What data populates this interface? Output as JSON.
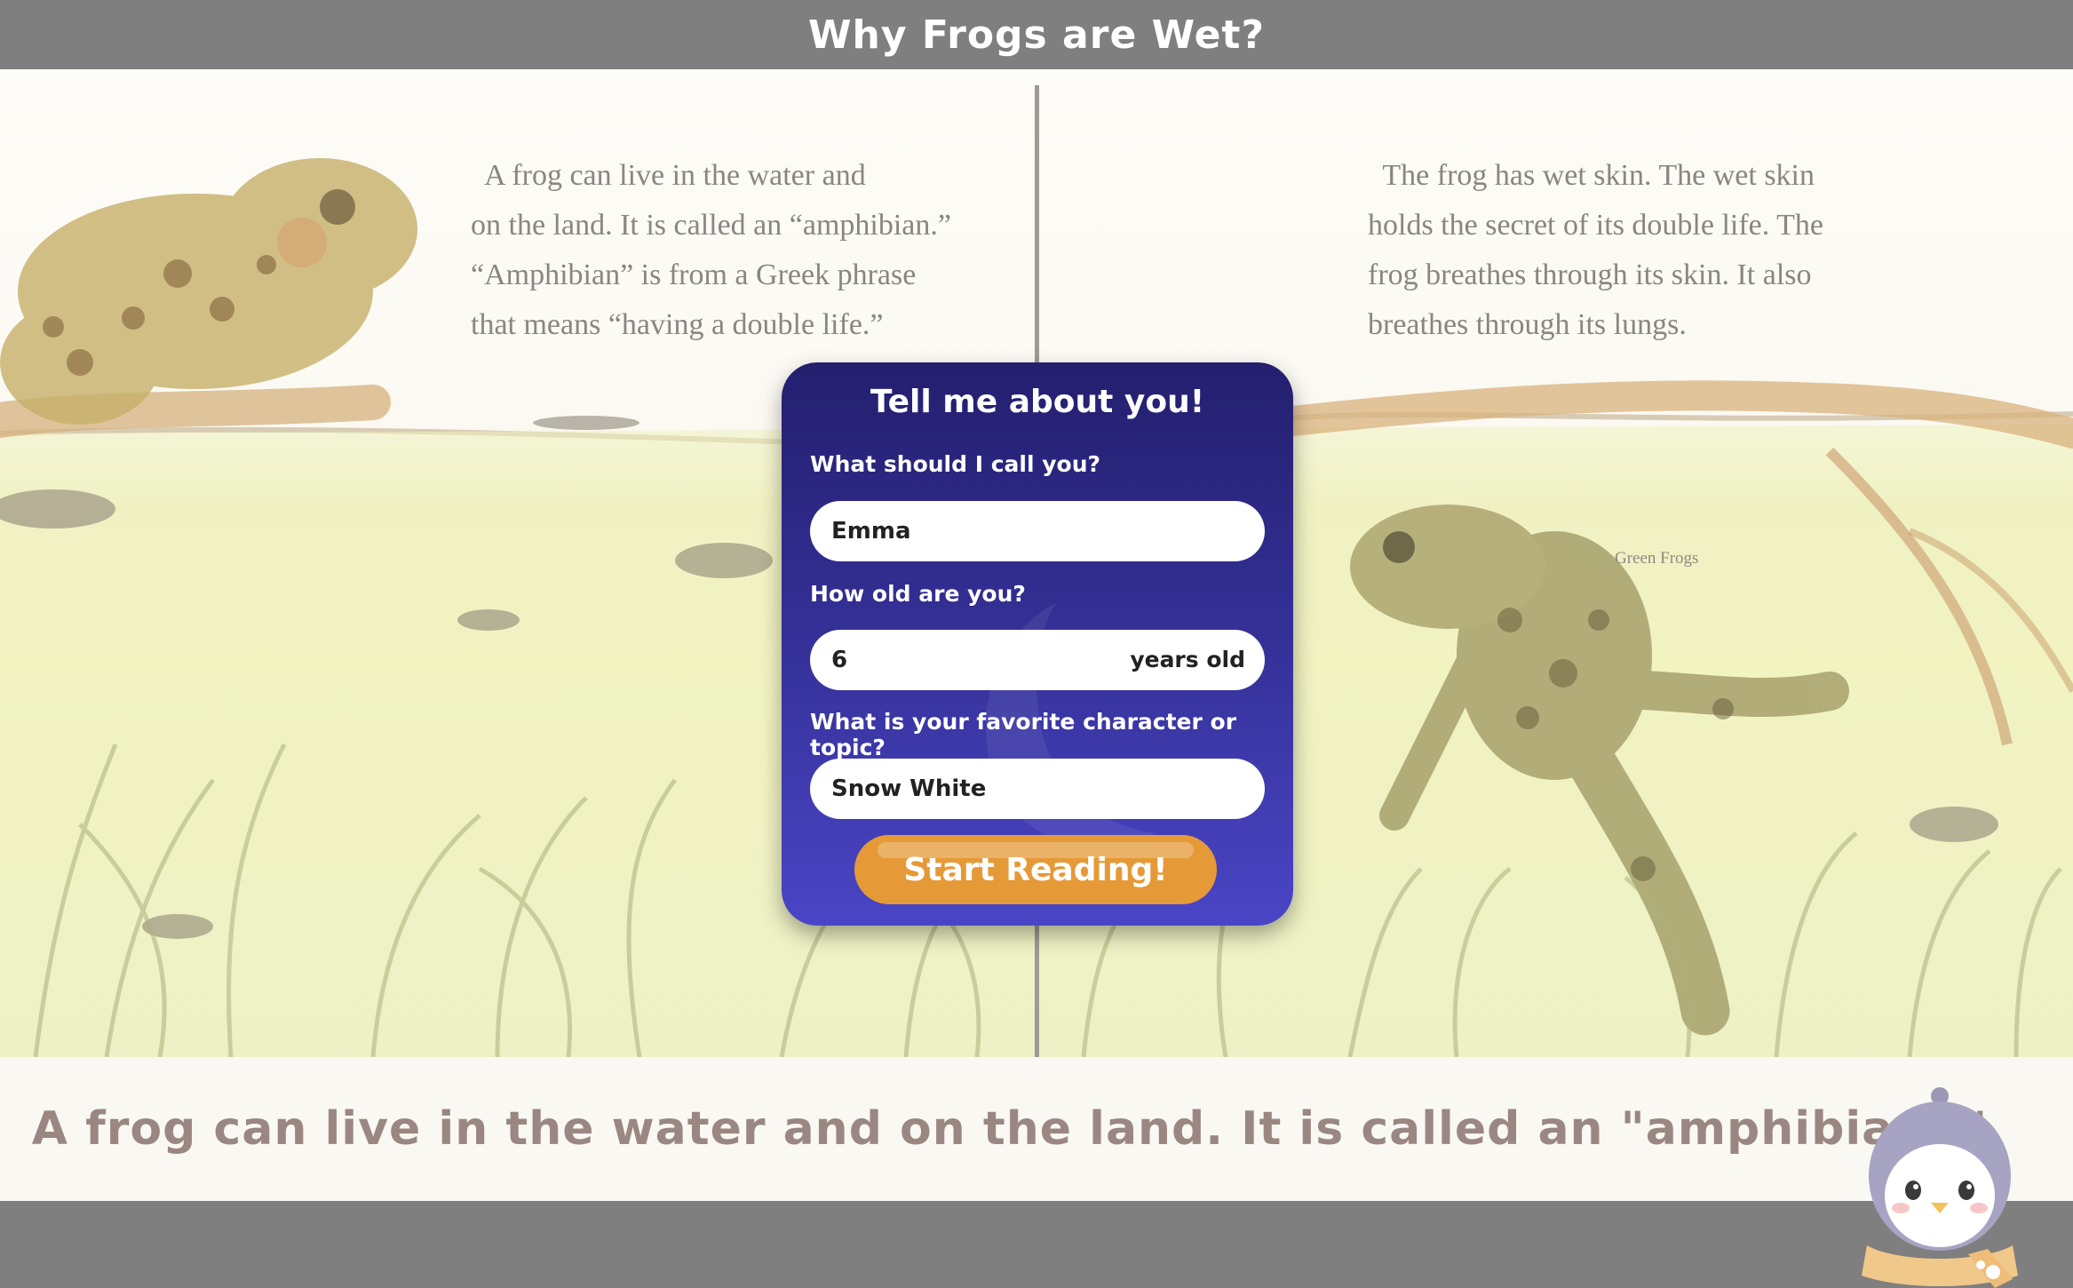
{
  "header": {
    "title": "Why Frogs are Wet?"
  },
  "book": {
    "left_page_lines": [
      "  A frog can live in the water and",
      "on the land. It is called an “amphibian.”",
      "“Amphibian” is from a Greek phrase",
      "that means “having a double life.”"
    ],
    "right_page_lines": [
      "  The frog has wet skin. The wet skin",
      "holds the secret of its double life. The",
      "frog breathes through its skin. It also",
      "breathes through its lungs."
    ],
    "figure_label": "Green Frogs"
  },
  "modal": {
    "title": "Tell me about you!",
    "name_label": "What should I call you?",
    "name_value": "Emma",
    "age_label": "How old are you?",
    "age_value": "6",
    "age_suffix": "years old",
    "topic_label": "What is your favorite character or topic?",
    "topic_value": "Snow White",
    "start_label": "Start Reading!"
  },
  "caption": {
    "text": "A frog can live in the water and on the land. It is called an \"amphibian. \""
  },
  "colors": {
    "bar": "#7f7f7f",
    "modal_top": "#241f6e",
    "modal_bottom": "#4a45c5",
    "button": "#e59a37",
    "caption_text": "#9b8782"
  },
  "icons": {
    "mascot": "penguin-mascot-icon"
  }
}
